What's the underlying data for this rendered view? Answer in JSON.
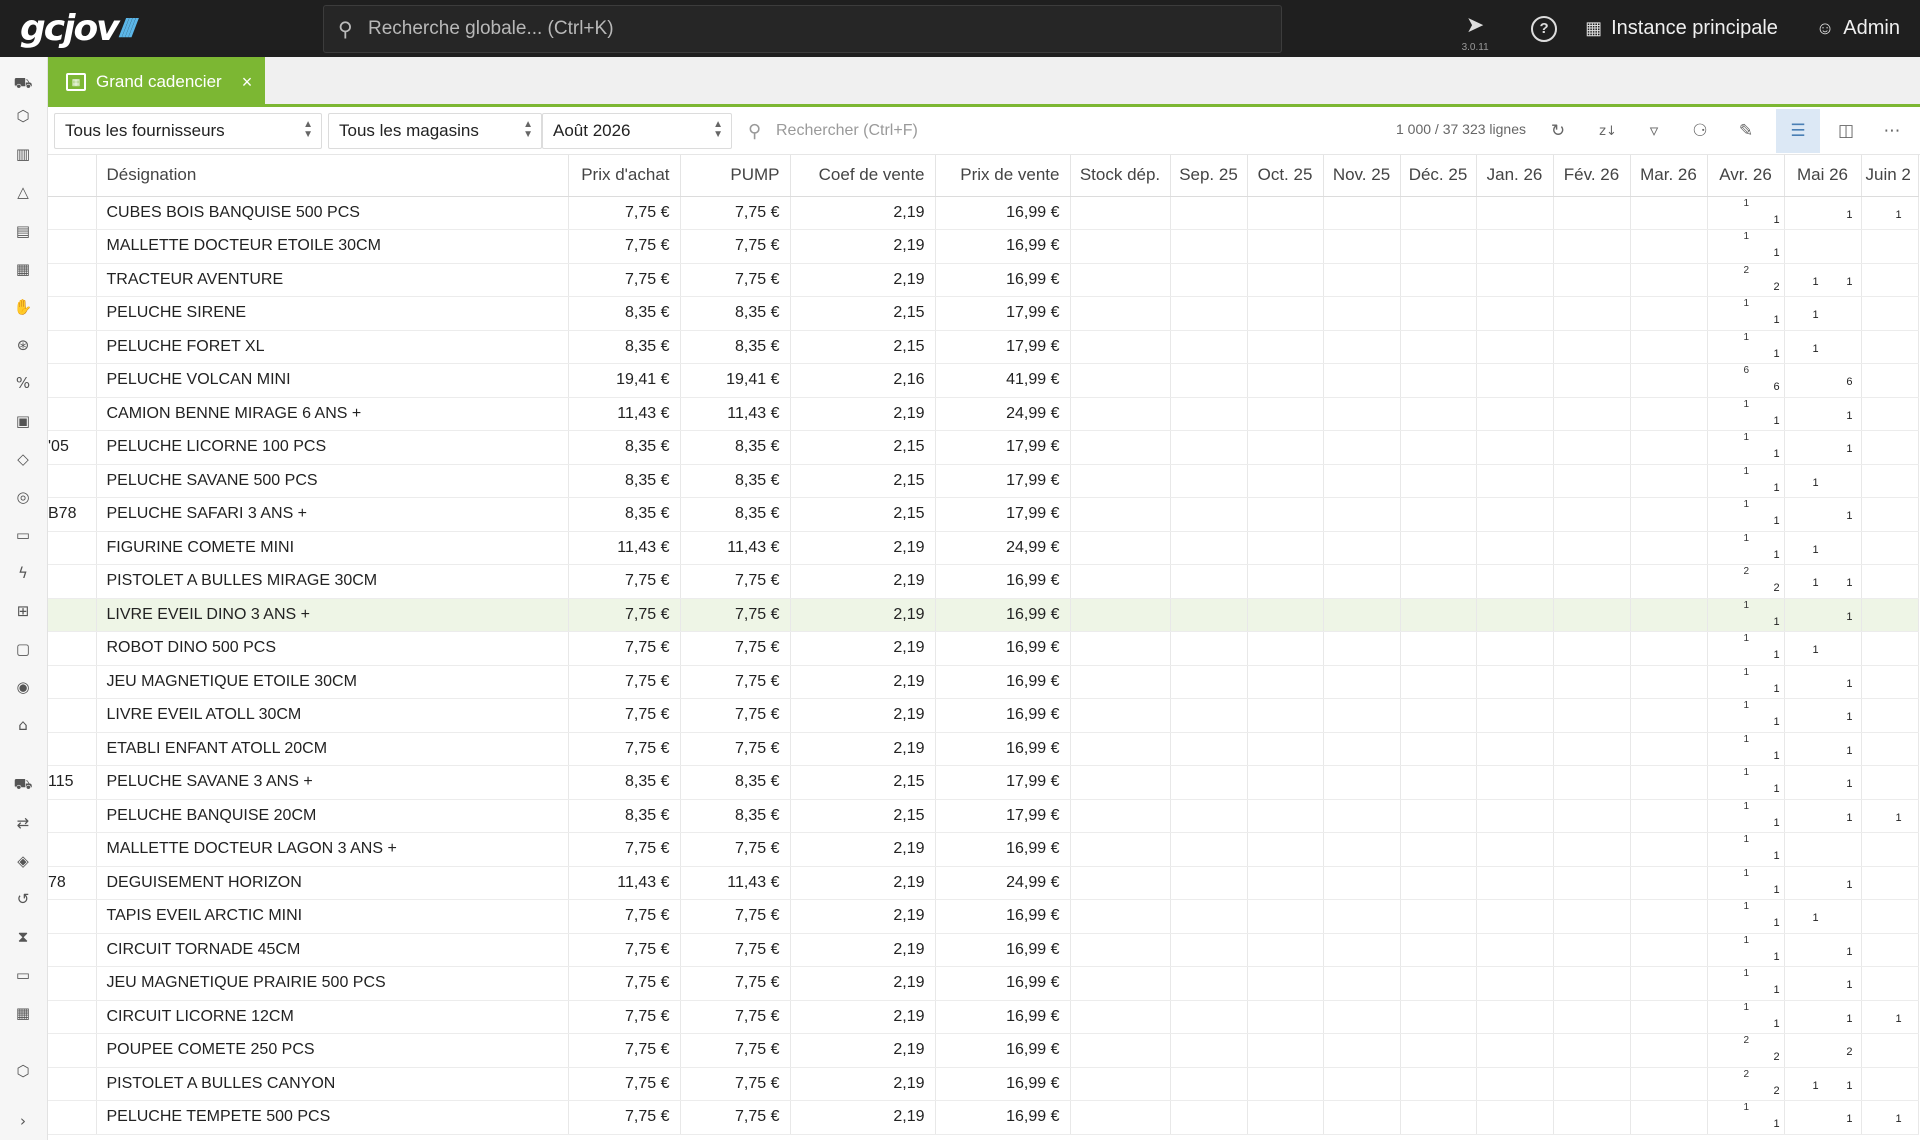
{
  "topbar": {
    "search_placeholder": "Recherche globale... (Ctrl+K)",
    "version": "3.0.11",
    "instance_label": "Instance principale",
    "user_label": "Admin"
  },
  "tab": {
    "label": "Grand cadencier",
    "close": "×"
  },
  "toolbar": {
    "supplier_select": "Tous les fournisseurs",
    "store_select": "Tous les magasins",
    "month_select": "Août 2026",
    "search_placeholder": "Rechercher (Ctrl+F)",
    "row_count": "1 000 / 37 323 lignes"
  },
  "columns": [
    "Désignation",
    "Prix d'achat",
    "PUMP",
    "Coef de vente",
    "Prix de vente",
    "Stock dép.",
    "Sep. 25",
    "Oct. 25",
    "Nov. 25",
    "Déc. 25",
    "Jan. 26",
    "Fév. 26",
    "Mar. 26",
    "Avr. 26",
    "Mai 26",
    "Juin 2"
  ],
  "rows": [
    {
      "ref": "",
      "des": "CUBES BOIS BANQUISE 500 PCS",
      "pa": "7,75 €",
      "pump": "7,75 €",
      "coef": "2,19",
      "pv": "16,99 €",
      "avr_top": "1",
      "avr_bot": "1",
      "mai": "1",
      "juin": "1"
    },
    {
      "ref": "",
      "des": "MALLETTE DOCTEUR ETOILE 30CM",
      "pa": "7,75 €",
      "pump": "7,75 €",
      "coef": "2,19",
      "pv": "16,99 €",
      "avr_top": "1",
      "avr_bot": "1",
      "mai": "",
      "juin": ""
    },
    {
      "ref": "",
      "des": "TRACTEUR AVENTURE",
      "pa": "7,75 €",
      "pump": "7,75 €",
      "coef": "2,19",
      "pv": "16,99 €",
      "avr_top": "2",
      "avr_bot": "2",
      "mai_l": "1",
      "mai": "1",
      "juin": ""
    },
    {
      "ref": "",
      "des": "PELUCHE SIRENE",
      "pa": "8,35 €",
      "pump": "8,35 €",
      "coef": "2,15",
      "pv": "17,99 €",
      "avr_top": "1",
      "avr_bot": "1",
      "mai_l": "1",
      "mai": "",
      "juin": ""
    },
    {
      "ref": "",
      "des": "PELUCHE FORET XL",
      "pa": "8,35 €",
      "pump": "8,35 €",
      "coef": "2,15",
      "pv": "17,99 €",
      "avr_top": "1",
      "avr_bot": "1",
      "mai_l": "1",
      "mai": "",
      "juin": ""
    },
    {
      "ref": "",
      "des": "PELUCHE VOLCAN MINI",
      "pa": "19,41 €",
      "pump": "19,41 €",
      "coef": "2,16",
      "pv": "41,99 €",
      "avr_top": "6",
      "avr_bot": "6",
      "mai": "6",
      "juin": ""
    },
    {
      "ref": "",
      "des": "CAMION BENNE MIRAGE 6 ANS +",
      "pa": "11,43 €",
      "pump": "11,43 €",
      "coef": "2,19",
      "pv": "24,99 €",
      "avr_top": "1",
      "avr_bot": "1",
      "mai": "1",
      "juin": ""
    },
    {
      "ref": "'05",
      "des": "PELUCHE LICORNE 100 PCS",
      "pa": "8,35 €",
      "pump": "8,35 €",
      "coef": "2,15",
      "pv": "17,99 €",
      "avr_top": "1",
      "avr_bot": "1",
      "mai": "1",
      "juin": ""
    },
    {
      "ref": "",
      "des": "PELUCHE SAVANE 500 PCS",
      "pa": "8,35 €",
      "pump": "8,35 €",
      "coef": "2,15",
      "pv": "17,99 €",
      "avr_top": "1",
      "avr_bot": "1",
      "mai_l": "1",
      "mai": "",
      "juin": ""
    },
    {
      "ref": "B78",
      "des": "PELUCHE SAFARI 3 ANS +",
      "pa": "8,35 €",
      "pump": "8,35 €",
      "coef": "2,15",
      "pv": "17,99 €",
      "avr_top": "1",
      "avr_bot": "1",
      "mai": "1",
      "juin": ""
    },
    {
      "ref": "",
      "des": "FIGURINE COMETE MINI",
      "pa": "11,43 €",
      "pump": "11,43 €",
      "coef": "2,19",
      "pv": "24,99 €",
      "avr_top": "1",
      "avr_bot": "1",
      "mai_l": "1",
      "mai": "",
      "juin": ""
    },
    {
      "ref": "",
      "des": "PISTOLET A BULLES MIRAGE 30CM",
      "pa": "7,75 €",
      "pump": "7,75 €",
      "coef": "2,19",
      "pv": "16,99 €",
      "avr_top": "2",
      "avr_bot": "2",
      "mai_l": "1",
      "mai": "1",
      "juin": ""
    },
    {
      "ref": "",
      "des": "LIVRE EVEIL DINO 3 ANS +",
      "pa": "7,75 €",
      "pump": "7,75 €",
      "coef": "2,19",
      "pv": "16,99 €",
      "avr_top": "1",
      "avr_bot": "1",
      "mai": "1",
      "juin": "",
      "highlight": "1"
    },
    {
      "ref": "",
      "des": "ROBOT DINO 500 PCS",
      "pa": "7,75 €",
      "pump": "7,75 €",
      "coef": "2,19",
      "pv": "16,99 €",
      "avr_top": "1",
      "avr_bot": "1",
      "mai_l": "1",
      "mai": "",
      "juin": ""
    },
    {
      "ref": "",
      "des": "JEU MAGNETIQUE ETOILE 30CM",
      "pa": "7,75 €",
      "pump": "7,75 €",
      "coef": "2,19",
      "pv": "16,99 €",
      "avr_top": "1",
      "avr_bot": "1",
      "mai": "1",
      "juin": ""
    },
    {
      "ref": "",
      "des": "LIVRE EVEIL ATOLL 30CM",
      "pa": "7,75 €",
      "pump": "7,75 €",
      "coef": "2,19",
      "pv": "16,99 €",
      "avr_top": "1",
      "avr_bot": "1",
      "mai": "1",
      "juin": ""
    },
    {
      "ref": "",
      "des": "ETABLI ENFANT ATOLL 20CM",
      "pa": "7,75 €",
      "pump": "7,75 €",
      "coef": "2,19",
      "pv": "16,99 €",
      "avr_top": "1",
      "avr_bot": "1",
      "mai": "1",
      "juin": ""
    },
    {
      "ref": "115",
      "des": "PELUCHE SAVANE 3 ANS +",
      "pa": "8,35 €",
      "pump": "8,35 €",
      "coef": "2,15",
      "pv": "17,99 €",
      "avr_top": "1",
      "avr_bot": "1",
      "mai": "1",
      "juin": ""
    },
    {
      "ref": "",
      "des": "PELUCHE BANQUISE 20CM",
      "pa": "8,35 €",
      "pump": "8,35 €",
      "coef": "2,15",
      "pv": "17,99 €",
      "avr_top": "1",
      "avr_bot": "1",
      "mai": "1",
      "juin": "1"
    },
    {
      "ref": "",
      "des": "MALLETTE DOCTEUR LAGON 3 ANS +",
      "pa": "7,75 €",
      "pump": "7,75 €",
      "coef": "2,19",
      "pv": "16,99 €",
      "avr_top": "1",
      "avr_bot": "1",
      "mai": "",
      "juin": ""
    },
    {
      "ref": "78",
      "des": "DEGUISEMENT HORIZON",
      "pa": "11,43 €",
      "pump": "11,43 €",
      "coef": "2,19",
      "pv": "24,99 €",
      "avr_top": "1",
      "avr_bot": "1",
      "mai": "1",
      "juin": ""
    },
    {
      "ref": "",
      "des": "TAPIS EVEIL ARCTIC MINI",
      "pa": "7,75 €",
      "pump": "7,75 €",
      "coef": "2,19",
      "pv": "16,99 €",
      "avr_top": "1",
      "avr_bot": "1",
      "mai_l": "1",
      "mai": "",
      "juin": ""
    },
    {
      "ref": "",
      "des": "CIRCUIT TORNADE 45CM",
      "pa": "7,75 €",
      "pump": "7,75 €",
      "coef": "2,19",
      "pv": "16,99 €",
      "avr_top": "1",
      "avr_bot": "1",
      "mai": "1",
      "juin": ""
    },
    {
      "ref": "",
      "des": "JEU MAGNETIQUE PRAIRIE 500 PCS",
      "pa": "7,75 €",
      "pump": "7,75 €",
      "coef": "2,19",
      "pv": "16,99 €",
      "avr_top": "1",
      "avr_bot": "1",
      "mai": "1",
      "juin": ""
    },
    {
      "ref": "",
      "des": "CIRCUIT LICORNE 12CM",
      "pa": "7,75 €",
      "pump": "7,75 €",
      "coef": "2,19",
      "pv": "16,99 €",
      "avr_top": "1",
      "avr_bot": "1",
      "mai": "1",
      "juin": "1"
    },
    {
      "ref": "",
      "des": "POUPEE COMETE 250 PCS",
      "pa": "7,75 €",
      "pump": "7,75 €",
      "coef": "2,19",
      "pv": "16,99 €",
      "avr_top": "2",
      "avr_bot": "2",
      "mai": "2",
      "juin": ""
    },
    {
      "ref": "",
      "des": "PISTOLET A BULLES CANYON",
      "pa": "7,75 €",
      "pump": "7,75 €",
      "coef": "2,19",
      "pv": "16,99 €",
      "avr_top": "2",
      "avr_bot": "2",
      "mai_l": "1",
      "mai": "1",
      "juin": ""
    },
    {
      "ref": "",
      "des": "PELUCHE TEMPETE 500 PCS",
      "pa": "7,75 €",
      "pump": "7,75 €",
      "coef": "2,19",
      "pv": "16,99 €",
      "avr_top": "1",
      "avr_bot": "1",
      "mai": "1",
      "juin": "1"
    }
  ],
  "colors": {
    "accent": "#7cb733",
    "topbar": "#1f1f1f",
    "highlight_row": "#eef5e6",
    "active_tool": "#dce8f5"
  },
  "sidebar_icons": [
    "truck-icon",
    "box-icon",
    "factory-icon",
    "shapes-icon",
    "ledger-icon",
    "building-icon",
    "handshake-icon",
    "discount-icon",
    "percent-icon",
    "label-list-icon",
    "tag-icon",
    "dashboard-icon",
    "battery-icon",
    "flash-icon",
    "hierarchy-icon",
    "scanner-icon",
    "palette-icon",
    "warehouse-icon",
    "delivery-icon",
    "transfer-icon",
    "package-icon",
    "return-icon",
    "hourglass-icon",
    "id-card-icon",
    "calendar-icon",
    "cube-icon",
    "expand-icon"
  ]
}
